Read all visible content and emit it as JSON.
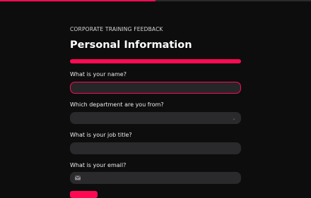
{
  "progress": {
    "fraction": 0.5,
    "color": "#ff0a52"
  },
  "form": {
    "eyebrow": "CORPORATE TRAINING FEEDBACK",
    "title": "Personal Information",
    "accent": "#ff0a52",
    "questions": [
      {
        "label": "What is your name?",
        "value": "",
        "type": "text"
      },
      {
        "label": "Which department are you from?",
        "value": "",
        "type": "select",
        "icon": "chevron-down-icon"
      },
      {
        "label": "What is your job title?",
        "value": "",
        "type": "text"
      },
      {
        "label": "What is your email?",
        "value": "",
        "type": "email",
        "icon": "mail-icon"
      }
    ]
  }
}
